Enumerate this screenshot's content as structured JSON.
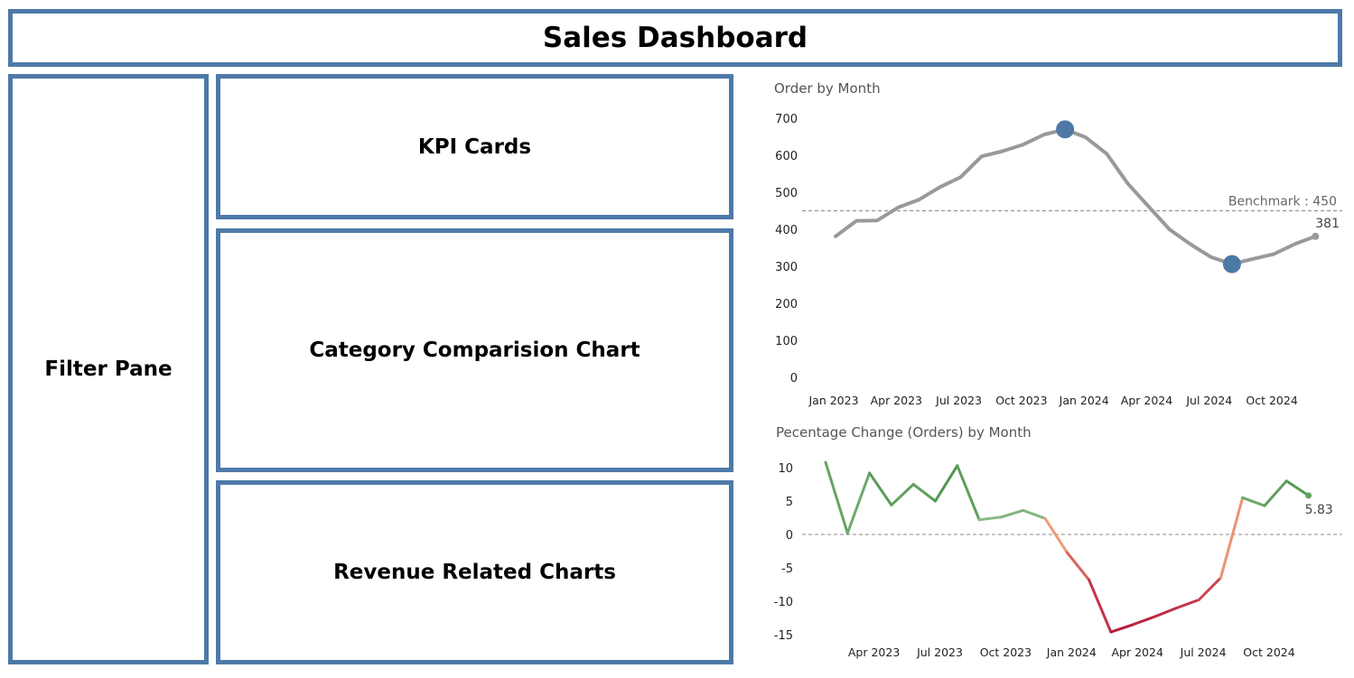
{
  "dashboard": {
    "title": "Sales Dashboard",
    "filter_pane_label": "Filter Pane",
    "kpi_label": "KPI Cards",
    "category_label": "Category Comparision Chart",
    "revenue_label": "Revenue Related Charts",
    "frame_color": "#4e79a7"
  },
  "chart_data": [
    {
      "type": "line",
      "title": "Order by Month",
      "x": [
        "Jan 2023",
        "Feb 2023",
        "Mar 2023",
        "Apr 2023",
        "May 2023",
        "Jun 2023",
        "Jul 2023",
        "Aug 2023",
        "Sep 2023",
        "Oct 2023",
        "Nov 2023",
        "Dec 2023",
        "Jan 2024",
        "Feb 2024",
        "Mar 2024",
        "Apr 2024",
        "May 2024",
        "Jun 2024",
        "Jul 2024",
        "Aug 2024",
        "Sep 2024",
        "Oct 2024",
        "Nov 2024",
        "Dec 2024"
      ],
      "values": [
        381,
        423,
        424,
        459,
        480,
        514,
        541,
        597,
        611,
        629,
        656,
        670,
        648,
        604,
        524,
        462,
        400,
        360,
        325,
        306,
        320,
        333,
        360,
        381
      ],
      "ylim": [
        0,
        700
      ],
      "yticks": [
        0,
        100,
        200,
        300,
        400,
        500,
        600,
        700
      ],
      "xtick_labels": [
        "Jan 2023",
        "Apr 2023",
        "Jul 2023",
        "Oct 2023",
        "Jan 2024",
        "Apr 2024",
        "Jul 2024",
        "Oct 2024"
      ],
      "benchmark": {
        "label": "Benchmark : 450",
        "value": 450
      },
      "end_label": "381",
      "highlight_points": [
        11,
        19
      ],
      "line_color": "#999999",
      "highlight_color": "#4e79a7",
      "grid": false
    },
    {
      "type": "line",
      "title": "Pecentage Change (Orders) by Month",
      "x": [
        "Feb 2023",
        "Mar 2023",
        "Apr 2023",
        "May 2023",
        "Jun 2023",
        "Jul 2023",
        "Aug 2023",
        "Sep 2023",
        "Oct 2023",
        "Nov 2023",
        "Dec 2023",
        "Jan 2024",
        "Feb 2024",
        "Mar 2024",
        "Apr 2024",
        "May 2024",
        "Jun 2024",
        "Jul 2024",
        "Aug 2024",
        "Sep 2024",
        "Oct 2024",
        "Nov 2024",
        "Dec 2024"
      ],
      "values": [
        10.8,
        0.2,
        9.2,
        4.4,
        7.5,
        5.0,
        10.3,
        2.2,
        2.6,
        3.6,
        2.4,
        -2.7,
        -6.8,
        -14.6,
        -13.5,
        -12.3,
        -11.0,
        -9.8,
        -6.5,
        5.5,
        4.3,
        8.0,
        5.83
      ],
      "ylim": [
        -15,
        10
      ],
      "yticks": [
        -15,
        -10,
        -5,
        0,
        5,
        10
      ],
      "xtick_labels": [
        "Apr 2023",
        "Jul 2023",
        "Oct 2023",
        "Jan 2024",
        "Apr 2024",
        "Jul 2024",
        "Oct 2024"
      ],
      "end_label": "5.83",
      "positive_color": "#3d8c3d",
      "negative_color": "#b3173c",
      "grid": false
    }
  ]
}
